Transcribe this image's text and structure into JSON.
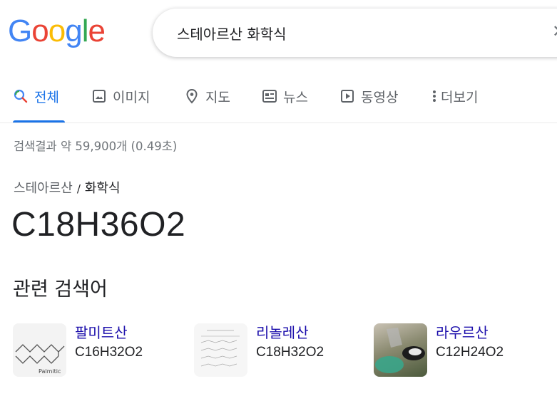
{
  "logo": {
    "letters": [
      "G",
      "o",
      "o",
      "g",
      "l",
      "e"
    ],
    "colors": [
      "#4285F4",
      "#EA4335",
      "#FBBC05",
      "#4285F4",
      "#34A853",
      "#EA4335"
    ]
  },
  "search": {
    "value": "스테아르산 화학식",
    "clear_icon": "close-icon"
  },
  "tabs": [
    {
      "label": "전체",
      "icon": "search-icon",
      "active": true
    },
    {
      "label": "이미지",
      "icon": "image-icon",
      "active": false
    },
    {
      "label": "지도",
      "icon": "location-pin-icon",
      "active": false
    },
    {
      "label": "뉴스",
      "icon": "news-icon",
      "active": false
    },
    {
      "label": "동영상",
      "icon": "play-icon",
      "active": false
    },
    {
      "label": "더보기",
      "icon": "more-vert-icon",
      "active": false
    }
  ],
  "results_stats": "검색결과 약 59,900개 (0.49초)",
  "breadcrumb": {
    "parent": "스테아르산",
    "separator": "/",
    "current": "화학식"
  },
  "answer": "C18H36O2",
  "related": {
    "title": "관련 검색어",
    "items": [
      {
        "name": "팔미트산",
        "formula": "C16H32O2",
        "thumb_caption": "Palmitic"
      },
      {
        "name": "리놀레산",
        "formula": "C18H32O2",
        "thumb_caption": ""
      },
      {
        "name": "라우르산",
        "formula": "C12H24O2",
        "thumb_caption": ""
      }
    ]
  },
  "colors": {
    "accent": "#1a73e8",
    "link": "#1a0dab",
    "muted": "#70757a"
  }
}
